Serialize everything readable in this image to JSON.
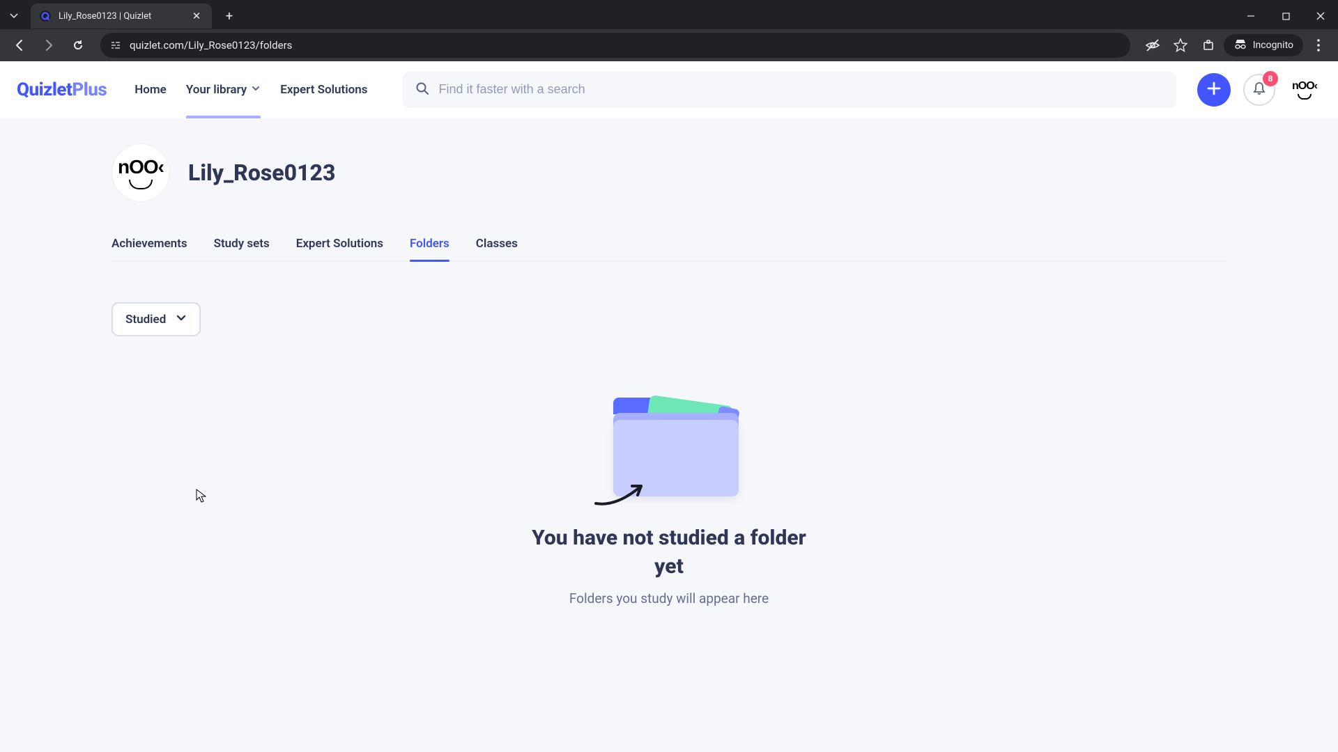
{
  "browser": {
    "tab_title": "Lily_Rose0123 | Quizlet",
    "url": "quizlet.com/Lily_Rose0123/folders",
    "incognito_label": "Incognito"
  },
  "header": {
    "logo_main": "Quizlet",
    "logo_suffix": "Plus",
    "nav": {
      "home": "Home",
      "your_library": "Your library",
      "expert_solutions": "Expert Solutions"
    },
    "search_placeholder": "Find it faster with a search",
    "notification_count": "8"
  },
  "profile": {
    "username": "Lily_Rose0123"
  },
  "tabs": {
    "items": [
      {
        "label": "Achievements"
      },
      {
        "label": "Study sets"
      },
      {
        "label": "Expert Solutions"
      },
      {
        "label": "Folders"
      },
      {
        "label": "Classes"
      }
    ],
    "active_index": 3
  },
  "filter": {
    "label": "Studied"
  },
  "empty": {
    "title": "You have not studied a folder yet",
    "subtitle": "Folders you study will appear here"
  }
}
